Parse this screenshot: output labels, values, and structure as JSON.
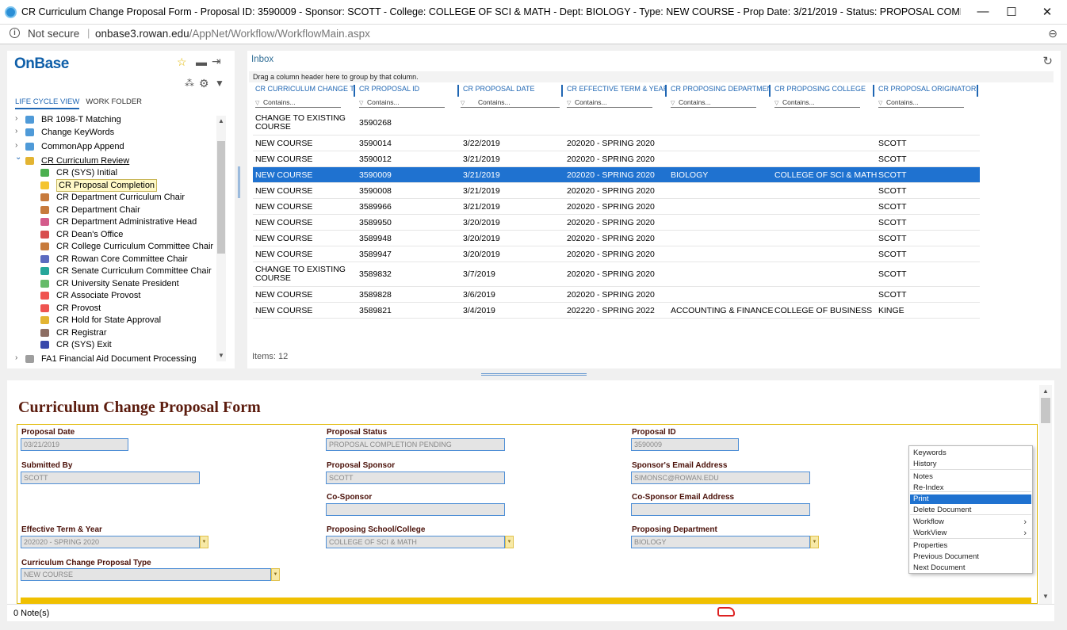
{
  "window": {
    "title": "CR Curriculum Change Proposal Form - Proposal ID: 3590009 - Sponsor: SCOTT - College: COLLEGE OF SCI & MATH - Dept: BIOLOGY - Type: NEW COURSE - Prop Date: 3/21/2019 - Status: PROPOSAL COMPLETION PENDIN...",
    "minimize": "—",
    "maximize": "☐",
    "close": "✕"
  },
  "address": {
    "security": "Not secure",
    "separator": "|",
    "domain": "onbase3.rowan.edu",
    "path": "/AppNet/Workflow/WorkflowMain.aspx"
  },
  "left": {
    "logo": "OnBase",
    "tabs": [
      "LIFE CYCLE VIEW",
      "WORK FOLDER"
    ],
    "tree": [
      {
        "label": "BR 1098-T Matching",
        "level": 0,
        "color": "#4f9ad8"
      },
      {
        "label": "Change KeyWords",
        "level": 0,
        "color": "#4f9ad8"
      },
      {
        "label": "CommonApp Append",
        "level": 0,
        "color": "#4f9ad8"
      },
      {
        "label": "CR Curriculum Review",
        "level": 0,
        "color": "#e3b432"
      },
      {
        "label": "CR (SYS) Initial",
        "level": 1,
        "color": "#4caf50"
      },
      {
        "label": "CR Proposal Completion",
        "level": 1,
        "color": "#f4c430"
      },
      {
        "label": "CR Department Curriculum Chair",
        "level": 1,
        "color": "#c77a3c"
      },
      {
        "label": "CR Department Chair",
        "level": 1,
        "color": "#c77a3c"
      },
      {
        "label": "CR Department Administrative Head",
        "level": 1,
        "color": "#d45b8b"
      },
      {
        "label": "CR Dean's Office",
        "level": 1,
        "color": "#d84d4d"
      },
      {
        "label": "CR College Curriculum Committee Chair",
        "level": 1,
        "color": "#c77a3c"
      },
      {
        "label": "CR Rowan Core Committee Chair",
        "level": 1,
        "color": "#5c6bc0"
      },
      {
        "label": "CR Senate Curriculum Committee Chair",
        "level": 1,
        "color": "#26a69a"
      },
      {
        "label": "CR University Senate President",
        "level": 1,
        "color": "#66bb6a"
      },
      {
        "label": "CR Associate Provost",
        "level": 1,
        "color": "#ef5350"
      },
      {
        "label": "CR Provost",
        "level": 1,
        "color": "#ef5350"
      },
      {
        "label": "CR Hold for State Approval",
        "level": 1,
        "color": "#e3b432"
      },
      {
        "label": "CR Registrar",
        "level": 1,
        "color": "#8d6e63"
      },
      {
        "label": "CR (SYS) Exit",
        "level": 1,
        "color": "#3949ab"
      },
      {
        "label": "FA1 Financial Aid Document Processing",
        "level": 0,
        "color": "#9e9e9e"
      }
    ]
  },
  "inbox": {
    "title": "Inbox",
    "group_hint": "Drag a column header here to group by that column.",
    "columns": [
      "CR CURRICULUM CHANGE TY...",
      "CR PROPOSAL ID",
      "CR PROPOSAL DATE",
      "CR EFFECTIVE TERM & YEAR",
      "CR PROPOSING DEPARTMENT",
      "CR PROPOSING COLLEGE",
      "CR PROPOSAL ORIGINATOR"
    ],
    "filter_placeholder": "Contains...",
    "rows": [
      [
        "CHANGE TO EXISTING COURSE",
        "3590268",
        "",
        "",
        "",
        "",
        ""
      ],
      [
        "NEW COURSE",
        "3590014",
        "3/22/2019",
        "202020 - SPRING 2020",
        "",
        "",
        "SCOTT"
      ],
      [
        "NEW COURSE",
        "3590012",
        "3/21/2019",
        "202020 - SPRING 2020",
        "",
        "",
        "SCOTT"
      ],
      [
        "NEW COURSE",
        "3590009",
        "3/21/2019",
        "202020 - SPRING 2020",
        "BIOLOGY",
        "COLLEGE OF SCI & MATH",
        "SCOTT"
      ],
      [
        "NEW COURSE",
        "3590008",
        "3/21/2019",
        "202020 - SPRING 2020",
        "",
        "",
        "SCOTT"
      ],
      [
        "NEW COURSE",
        "3589966",
        "3/21/2019",
        "202020 - SPRING 2020",
        "",
        "",
        "SCOTT"
      ],
      [
        "NEW COURSE",
        "3589950",
        "3/20/2019",
        "202020 - SPRING 2020",
        "",
        "",
        "SCOTT"
      ],
      [
        "NEW COURSE",
        "3589948",
        "3/20/2019",
        "202020 - SPRING 2020",
        "",
        "",
        "SCOTT"
      ],
      [
        "NEW COURSE",
        "3589947",
        "3/20/2019",
        "202020 - SPRING 2020",
        "",
        "",
        "SCOTT"
      ],
      [
        "CHANGE TO EXISTING COURSE",
        "3589832",
        "3/7/2019",
        "202020 - SPRING 2020",
        "",
        "",
        "SCOTT"
      ],
      [
        "NEW COURSE",
        "3589828",
        "3/6/2019",
        "202020 - SPRING 2020",
        "",
        "",
        "SCOTT"
      ],
      [
        "NEW COURSE",
        "3589821",
        "3/4/2019",
        "202220 - SPRING 2022",
        "ACCOUNTING & FINANCE",
        "COLLEGE OF BUSINESS",
        "KINGE"
      ]
    ],
    "items": "Items: 12"
  },
  "form": {
    "title": "Curriculum Change Proposal Form",
    "proposal_date_label": "Proposal Date",
    "proposal_date": "03/21/2019",
    "proposal_status_label": "Proposal Status",
    "proposal_status": "PROPOSAL COMPLETION PENDING",
    "proposal_id_label": "Proposal ID",
    "proposal_id": "3590009",
    "submitted_by_label": "Submitted By",
    "submitted_by": "SCOTT",
    "proposal_sponsor_label": "Proposal Sponsor",
    "proposal_sponsor": "SCOTT",
    "sponsor_email_label": "Sponsor's Email Address",
    "sponsor_email": "SIMONSC@ROWAN.EDU",
    "cosponsor_label": "Co-Sponsor",
    "cosponsor": "",
    "cosponsor_email_label": "Co-Sponsor Email Address",
    "cosponsor_email": "",
    "term_label": "Effective Term & Year",
    "term": "202020 - SPRING 2020",
    "school_label": "Proposing School/College",
    "school": "COLLEGE OF SCI & MATH",
    "dept_label": "Proposing Department",
    "dept": "BIOLOGY",
    "type_label": "Curriculum Change Proposal Type",
    "type": "NEW COURSE"
  },
  "context_menu": [
    {
      "label": "Keywords"
    },
    {
      "label": "History"
    },
    {
      "label": "Notes"
    },
    {
      "label": "Re-Index"
    },
    {
      "label": "Print",
      "highlighted": true
    },
    {
      "label": "Delete Document"
    },
    {
      "label": "Workflow",
      "submenu": true
    },
    {
      "label": "WorkView",
      "submenu": true
    },
    {
      "label": "Properties"
    },
    {
      "label": "Previous Document"
    },
    {
      "label": "Next Document"
    }
  ],
  "status": {
    "notes": "0 Note(s)"
  }
}
